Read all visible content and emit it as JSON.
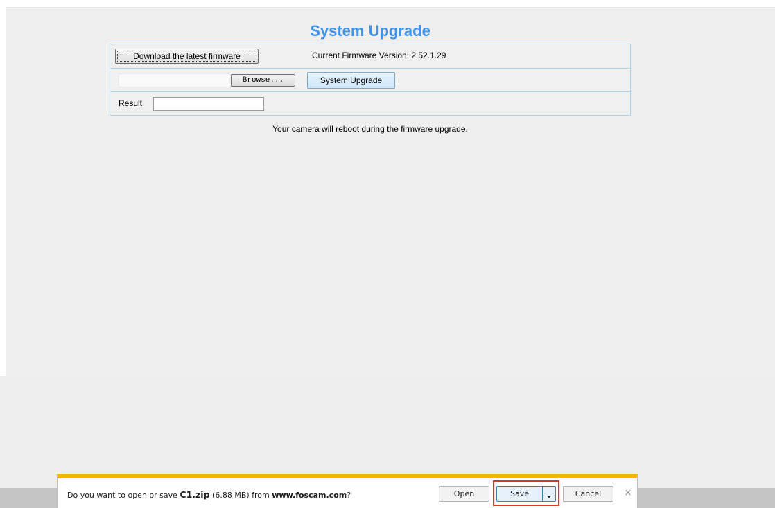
{
  "page": {
    "title": "System Upgrade",
    "download_latest_label": "Download the latest firmware",
    "firmware_version_text": "Current Firmware Version: 2.52.1.29",
    "browse_label": "Browse...",
    "system_upgrade_label": "System Upgrade",
    "result_label": "Result",
    "result_value": "",
    "reboot_note": "Your camera will reboot during the firmware upgrade."
  },
  "download_bar": {
    "prompt_prefix": "Do you want to open or save ",
    "filename": "C1.zip",
    "file_size": " (6.88 MB) from ",
    "site": "www.foscam.com",
    "prompt_suffix": "?",
    "open_label": "Open",
    "save_label": "Save",
    "cancel_label": "Cancel",
    "close_glyph": "×",
    "accent_color": "#f4b400",
    "highlight_color": "#e0312c"
  },
  "colors": {
    "title": "#3f93e8",
    "table_border": "#a9d4ec"
  },
  "icons": {
    "save_dropdown": "chevron-down-icon",
    "close": "close-icon"
  }
}
